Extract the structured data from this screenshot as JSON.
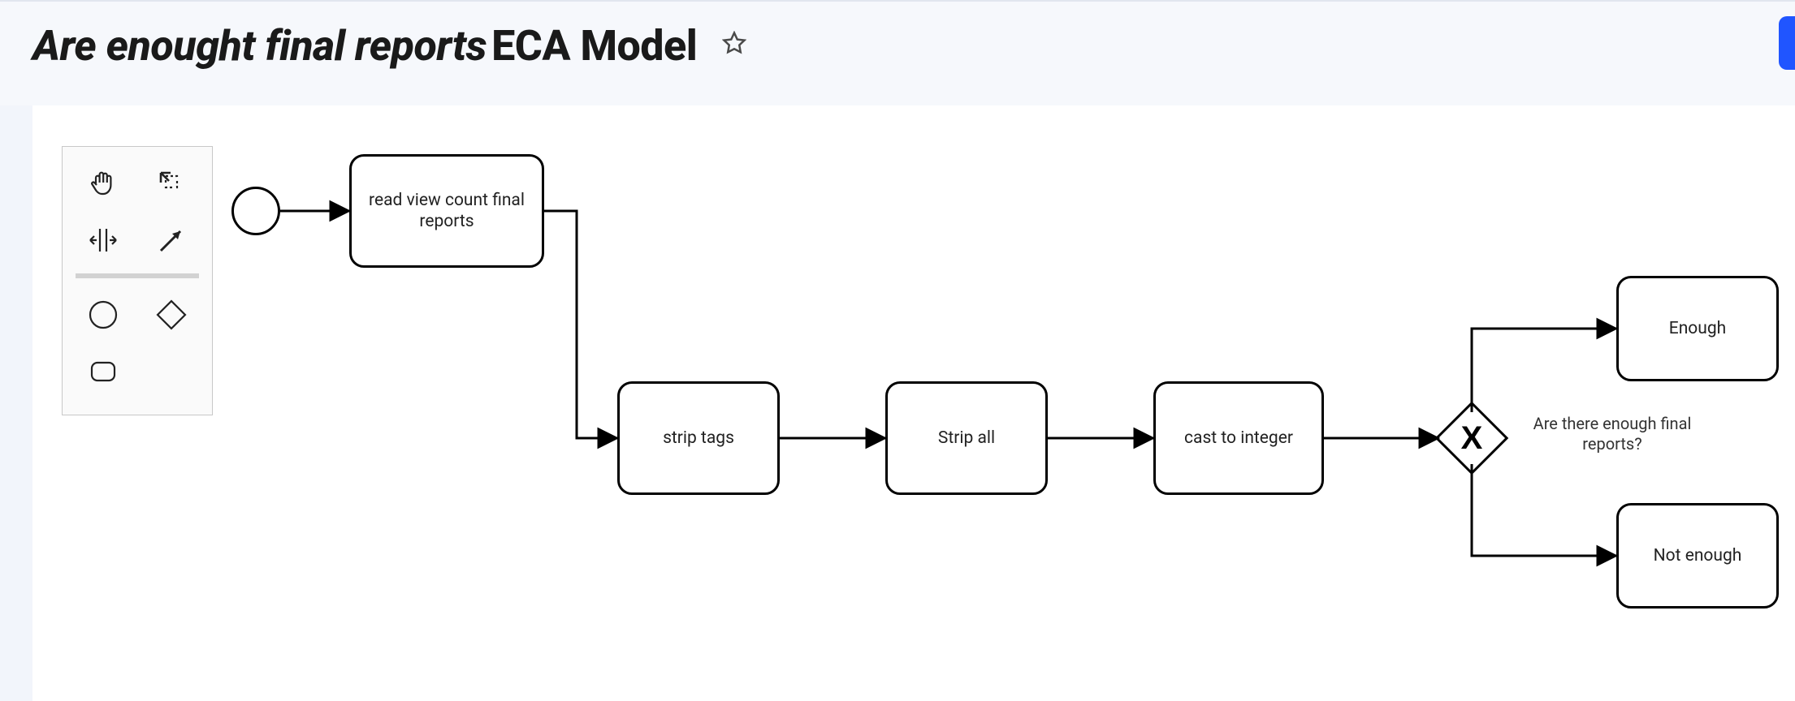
{
  "header": {
    "title_italic": "Are enought final reports",
    "title_suffix": "ECA Model"
  },
  "palette": {
    "tools": {
      "hand": "hand-tool",
      "lasso": "lasso-select",
      "space": "space-tool",
      "connect": "global-connect",
      "start_event": "start-event",
      "gateway": "gateway",
      "task": "task"
    }
  },
  "diagram": {
    "start_event": "",
    "task_read_view": "read view count final reports",
    "task_strip_tags": "strip tags",
    "task_strip_all": "Strip all",
    "task_cast_int": "cast to integer",
    "gateway_label": "Are there enough final reports?",
    "task_enough": "Enough",
    "task_not_enough": "Not enough"
  }
}
